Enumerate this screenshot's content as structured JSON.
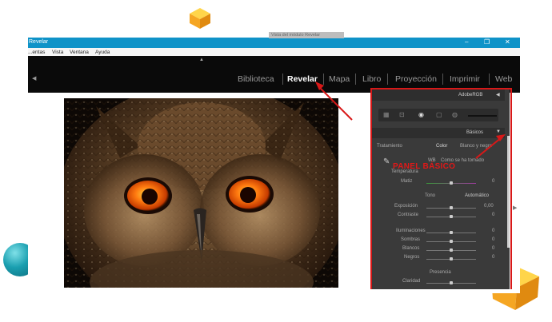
{
  "window": {
    "title": "Revelar",
    "controls": [
      "–",
      "❐",
      "✕"
    ]
  },
  "menu": [
    "...entas",
    "Vista",
    "Ventana",
    "Ayuda"
  ],
  "modules": [
    {
      "label": "Biblioteca",
      "active": false
    },
    {
      "label": "Revelar",
      "active": true
    },
    {
      "label": "Mapa",
      "active": false
    },
    {
      "label": "Libro",
      "active": false
    },
    {
      "label": "Proyección",
      "active": false
    },
    {
      "label": "Imprimir",
      "active": false
    },
    {
      "label": "Web",
      "active": false
    }
  ],
  "tooltip": "Vista del módulo Revelar",
  "panel": {
    "profile": "AdobeRGB",
    "basic_header": "Básicos",
    "treatment_label": "Tratamiento",
    "treatment_color": "Color",
    "treatment_bw": "Blanco y negro",
    "wb_label": "WB",
    "wb_value": "Como se ha tomado",
    "temperature": "Temperatura",
    "tint": "Matiz",
    "tone_header": "Tono",
    "auto": "Automático",
    "exposure": "Exposición",
    "exposure_value": "0,00",
    "contrast": "Contraste",
    "highlights": "Iluminaciones",
    "shadows": "Sombras",
    "whites": "Blancos",
    "blacks": "Negros",
    "presence_header": "Presencia",
    "clarity": "Claridad",
    "zero": "0",
    "annotation": "PANEL BÁSICO"
  },
  "colors": {
    "accent_red": "#d81818",
    "titlebar_blue": "#0f93c8",
    "cube_orange": "#f5a623",
    "sphere_teal": "#1a9fb0"
  }
}
